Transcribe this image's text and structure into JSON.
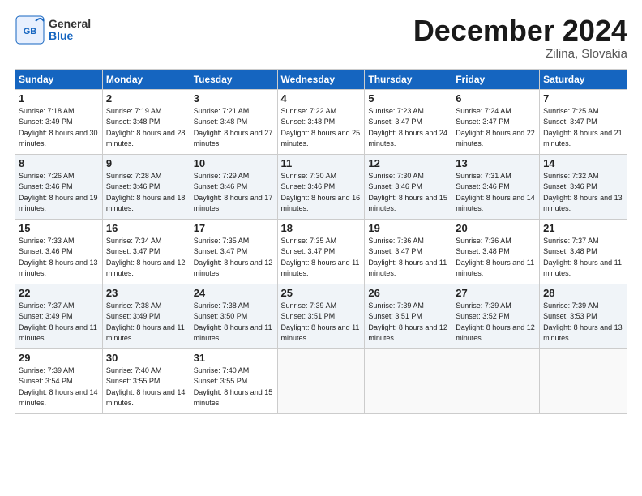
{
  "header": {
    "logo_general": "General",
    "logo_blue": "Blue",
    "title": "December 2024",
    "location": "Zilina, Slovakia"
  },
  "weekdays": [
    "Sunday",
    "Monday",
    "Tuesday",
    "Wednesday",
    "Thursday",
    "Friday",
    "Saturday"
  ],
  "weeks": [
    [
      {
        "day": "1",
        "sunrise": "Sunrise: 7:18 AM",
        "sunset": "Sunset: 3:49 PM",
        "daylight": "Daylight: 8 hours and 30 minutes."
      },
      {
        "day": "2",
        "sunrise": "Sunrise: 7:19 AM",
        "sunset": "Sunset: 3:48 PM",
        "daylight": "Daylight: 8 hours and 28 minutes."
      },
      {
        "day": "3",
        "sunrise": "Sunrise: 7:21 AM",
        "sunset": "Sunset: 3:48 PM",
        "daylight": "Daylight: 8 hours and 27 minutes."
      },
      {
        "day": "4",
        "sunrise": "Sunrise: 7:22 AM",
        "sunset": "Sunset: 3:48 PM",
        "daylight": "Daylight: 8 hours and 25 minutes."
      },
      {
        "day": "5",
        "sunrise": "Sunrise: 7:23 AM",
        "sunset": "Sunset: 3:47 PM",
        "daylight": "Daylight: 8 hours and 24 minutes."
      },
      {
        "day": "6",
        "sunrise": "Sunrise: 7:24 AM",
        "sunset": "Sunset: 3:47 PM",
        "daylight": "Daylight: 8 hours and 22 minutes."
      },
      {
        "day": "7",
        "sunrise": "Sunrise: 7:25 AM",
        "sunset": "Sunset: 3:47 PM",
        "daylight": "Daylight: 8 hours and 21 minutes."
      }
    ],
    [
      {
        "day": "8",
        "sunrise": "Sunrise: 7:26 AM",
        "sunset": "Sunset: 3:46 PM",
        "daylight": "Daylight: 8 hours and 19 minutes."
      },
      {
        "day": "9",
        "sunrise": "Sunrise: 7:28 AM",
        "sunset": "Sunset: 3:46 PM",
        "daylight": "Daylight: 8 hours and 18 minutes."
      },
      {
        "day": "10",
        "sunrise": "Sunrise: 7:29 AM",
        "sunset": "Sunset: 3:46 PM",
        "daylight": "Daylight: 8 hours and 17 minutes."
      },
      {
        "day": "11",
        "sunrise": "Sunrise: 7:30 AM",
        "sunset": "Sunset: 3:46 PM",
        "daylight": "Daylight: 8 hours and 16 minutes."
      },
      {
        "day": "12",
        "sunrise": "Sunrise: 7:30 AM",
        "sunset": "Sunset: 3:46 PM",
        "daylight": "Daylight: 8 hours and 15 minutes."
      },
      {
        "day": "13",
        "sunrise": "Sunrise: 7:31 AM",
        "sunset": "Sunset: 3:46 PM",
        "daylight": "Daylight: 8 hours and 14 minutes."
      },
      {
        "day": "14",
        "sunrise": "Sunrise: 7:32 AM",
        "sunset": "Sunset: 3:46 PM",
        "daylight": "Daylight: 8 hours and 13 minutes."
      }
    ],
    [
      {
        "day": "15",
        "sunrise": "Sunrise: 7:33 AM",
        "sunset": "Sunset: 3:46 PM",
        "daylight": "Daylight: 8 hours and 13 minutes."
      },
      {
        "day": "16",
        "sunrise": "Sunrise: 7:34 AM",
        "sunset": "Sunset: 3:47 PM",
        "daylight": "Daylight: 8 hours and 12 minutes."
      },
      {
        "day": "17",
        "sunrise": "Sunrise: 7:35 AM",
        "sunset": "Sunset: 3:47 PM",
        "daylight": "Daylight: 8 hours and 12 minutes."
      },
      {
        "day": "18",
        "sunrise": "Sunrise: 7:35 AM",
        "sunset": "Sunset: 3:47 PM",
        "daylight": "Daylight: 8 hours and 11 minutes."
      },
      {
        "day": "19",
        "sunrise": "Sunrise: 7:36 AM",
        "sunset": "Sunset: 3:47 PM",
        "daylight": "Daylight: 8 hours and 11 minutes."
      },
      {
        "day": "20",
        "sunrise": "Sunrise: 7:36 AM",
        "sunset": "Sunset: 3:48 PM",
        "daylight": "Daylight: 8 hours and 11 minutes."
      },
      {
        "day": "21",
        "sunrise": "Sunrise: 7:37 AM",
        "sunset": "Sunset: 3:48 PM",
        "daylight": "Daylight: 8 hours and 11 minutes."
      }
    ],
    [
      {
        "day": "22",
        "sunrise": "Sunrise: 7:37 AM",
        "sunset": "Sunset: 3:49 PM",
        "daylight": "Daylight: 8 hours and 11 minutes."
      },
      {
        "day": "23",
        "sunrise": "Sunrise: 7:38 AM",
        "sunset": "Sunset: 3:49 PM",
        "daylight": "Daylight: 8 hours and 11 minutes."
      },
      {
        "day": "24",
        "sunrise": "Sunrise: 7:38 AM",
        "sunset": "Sunset: 3:50 PM",
        "daylight": "Daylight: 8 hours and 11 minutes."
      },
      {
        "day": "25",
        "sunrise": "Sunrise: 7:39 AM",
        "sunset": "Sunset: 3:51 PM",
        "daylight": "Daylight: 8 hours and 11 minutes."
      },
      {
        "day": "26",
        "sunrise": "Sunrise: 7:39 AM",
        "sunset": "Sunset: 3:51 PM",
        "daylight": "Daylight: 8 hours and 12 minutes."
      },
      {
        "day": "27",
        "sunrise": "Sunrise: 7:39 AM",
        "sunset": "Sunset: 3:52 PM",
        "daylight": "Daylight: 8 hours and 12 minutes."
      },
      {
        "day": "28",
        "sunrise": "Sunrise: 7:39 AM",
        "sunset": "Sunset: 3:53 PM",
        "daylight": "Daylight: 8 hours and 13 minutes."
      }
    ],
    [
      {
        "day": "29",
        "sunrise": "Sunrise: 7:39 AM",
        "sunset": "Sunset: 3:54 PM",
        "daylight": "Daylight: 8 hours and 14 minutes."
      },
      {
        "day": "30",
        "sunrise": "Sunrise: 7:40 AM",
        "sunset": "Sunset: 3:55 PM",
        "daylight": "Daylight: 8 hours and 14 minutes."
      },
      {
        "day": "31",
        "sunrise": "Sunrise: 7:40 AM",
        "sunset": "Sunset: 3:55 PM",
        "daylight": "Daylight: 8 hours and 15 minutes."
      },
      null,
      null,
      null,
      null
    ]
  ]
}
